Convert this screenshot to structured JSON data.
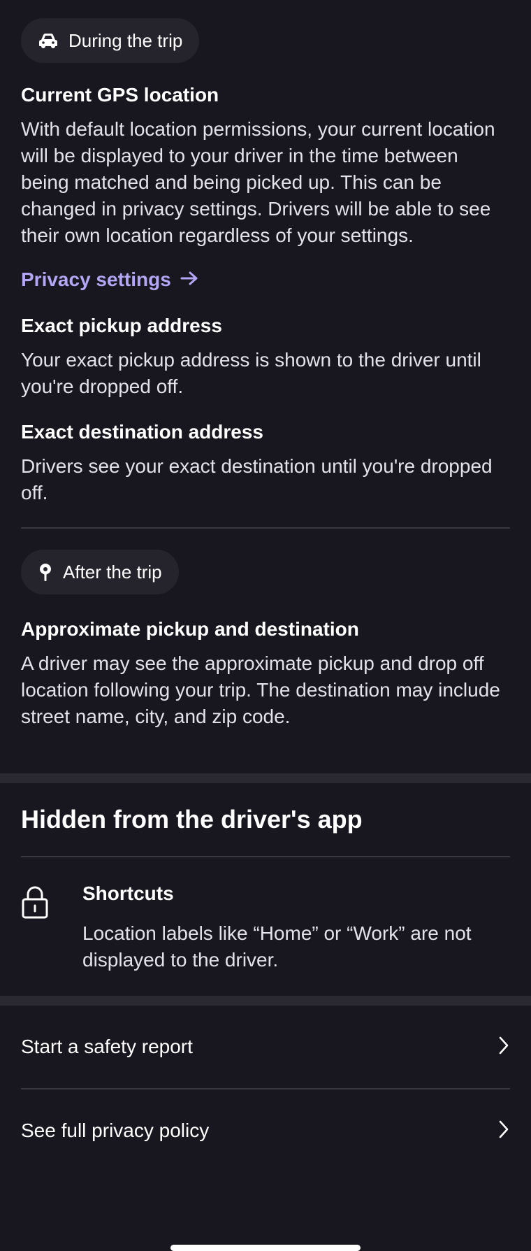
{
  "during_trip": {
    "pill_label": "During the trip",
    "pill_icon": "car-icon",
    "gps": {
      "title": "Current GPS location",
      "body": "With default location permissions, your current location will be displayed to your driver in the time between being matched and being picked up. This can be changed in privacy settings. Drivers will be able to see their own location regardless of your settings."
    },
    "privacy_link": {
      "label": "Privacy settings",
      "icon": "arrow-right-icon"
    },
    "pickup": {
      "title": "Exact pickup address",
      "body": "Your exact pickup address is shown to the driver until you're dropped off."
    },
    "destination": {
      "title": "Exact destination address",
      "body": "Drivers see your exact destination until you're dropped off."
    }
  },
  "after_trip": {
    "pill_label": "After the trip",
    "pill_icon": "location-pin-icon",
    "approx": {
      "title": "Approximate pickup and destination",
      "body": "A driver may see the approximate pickup and drop off location following your trip. The destination may include street name, city, and zip code."
    }
  },
  "hidden": {
    "title": "Hidden from the driver's app",
    "shortcuts": {
      "icon": "lock-icon",
      "title": "Shortcuts",
      "body": "Location labels like “Home” or “Work” are not displayed to the driver."
    }
  },
  "actions": [
    {
      "label": "Start a safety report",
      "icon": "chevron-right-icon"
    },
    {
      "label": "See full privacy policy",
      "icon": "chevron-right-icon"
    }
  ],
  "colors": {
    "background": "#18171f",
    "pill_background": "#25242d",
    "link": "#b3a6f5",
    "divider": "#3a3942"
  }
}
